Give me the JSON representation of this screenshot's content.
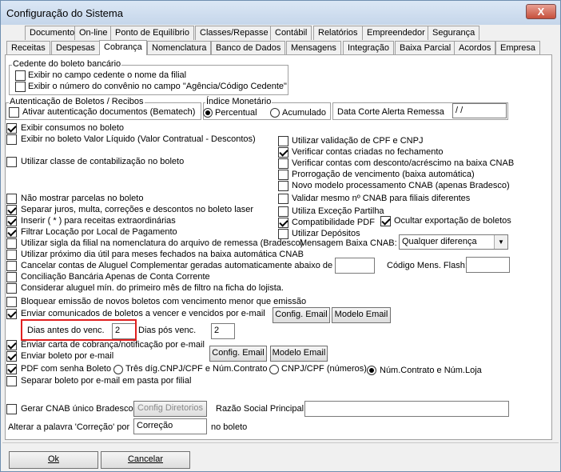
{
  "window": {
    "title": "Configuração do Sistema",
    "close_glyph": "X"
  },
  "tabs_row1": [
    "Documentos",
    "On-line",
    "Ponto de Equilíbrio",
    "Classes/Repasse",
    "Contábil",
    "Relatórios",
    "Empreendedor",
    "Segurança"
  ],
  "tabs_row2": [
    "Receitas",
    "Despesas",
    "Cobrança",
    "Nomenclatura",
    "Banco de Dados",
    "Mensagens",
    "Integração",
    "Baixa Parcial",
    "Acordos",
    "Empresa"
  ],
  "cedente": {
    "title": "Cedente do boleto bancário",
    "opt1": "Exibir no campo cedente o nome da filial",
    "opt2": "Exibir o número do convênio no campo \"Agência/Código Cedente\""
  },
  "autenticacao": {
    "title": "Autenticação de Boletos / Recibos",
    "opt": "Ativar autenticação documentos (Bematech)"
  },
  "indice": {
    "title": "Índice Monetário",
    "opt1": "Percentual",
    "opt2": "Acumulado"
  },
  "alerta": {
    "label": "Data Corte Alerta Remessa",
    "value": "/ /"
  },
  "left_opts": {
    "exibir_consumos": "Exibir consumos no boleto",
    "exibir_liquido": "Exibir no boleto Valor Líquido (Valor Contratual - Descontos)",
    "classe_contab": "Utilizar classe de contabilização no boleto",
    "nao_parcelas": "Não mostrar parcelas no boleto",
    "separar_juros": "Separar juros, multa, correções e descontos no boleto laser",
    "inserir": "Inserir ( * ) para receitas extraordinárias",
    "filtrar": "Filtrar Locação por Local de Pagamento",
    "sigla": "Utilizar sigla da filial na nomenclatura do arquivo de remessa (Bradesco)",
    "proximo_dia": "Utilizar próximo dia útil para meses fechados na baixa automática CNAB",
    "cancelar_aluguel": "Cancelar contas de Aluguel Complementar geradas automaticamente abaixo de R$",
    "conciliacao": "Conciliação Bancária Apenas de Conta Corrente",
    "considerar": "Considerar aluguel mín. do primeiro mês de filtro na ficha do lojista.",
    "bloquear": "Bloquear emissão de novos boletos com vencimento menor que emissão",
    "enviar_comunicados": "Enviar comunicados de boletos a vencer e vencidos por e-mail",
    "enviar_carta": "Enviar carta de cobrança/notificação por e-mail",
    "enviar_boleto": "Enviar boleto por e-mail",
    "pdf_senha": "PDF com senha Boleto",
    "separar_pasta": "Separar boleto por e-mail em pasta por filial"
  },
  "right_opts": {
    "validacao": "Utilizar validação de CPF e CNPJ",
    "verificar_criadas": "Verificar contas criadas no fechamento",
    "verificar_desconto": "Verificar contas com desconto/acréscimo na baixa CNAB",
    "prorrogacao": "Prorrogação de vencimento (baixa automática)",
    "novo_modelo": "Novo modelo processamento CNAB (apenas Bradesco)",
    "validar_cnab": "Validar mesmo nº CNAB para filiais diferentes",
    "excecao": "Utiliza Exceção Partilha",
    "compat_pdf": "Compatibilidade PDF",
    "ocultar": "Ocultar exportação de boletos",
    "depositos": "Utilizar Depósitos"
  },
  "mensagem_baixa": {
    "label": "Mensagem Baixa CNAB:",
    "value": "Qualquer diferença"
  },
  "codigo_flash": {
    "label": "Código Mens. Flash:",
    "value": ""
  },
  "cancelar_valor": "",
  "dias": {
    "antes_label": "Dias antes do venc.",
    "antes_value": "2",
    "pos_label": "Dias pós venc.",
    "pos_value": "2"
  },
  "buttons": {
    "config_email": "Config. Email",
    "modelo_email": "Modelo Email",
    "config_diretorios": "Config Diretorios",
    "ok": "Ok",
    "cancelar": "Cancelar"
  },
  "pdf_radio": {
    "opt1": "Três díg.CNPJ/CPF e Núm.Contrato",
    "opt2": "CNPJ/CPF (números)",
    "opt3": "Núm.Contrato e Núm.Loja"
  },
  "gerar_cnab": "Gerar CNAB único Bradesco",
  "razao_social": {
    "label": "Razão Social Principal",
    "value": ""
  },
  "alterar": {
    "label": "Alterar a palavra 'Correção' por",
    "value": "Correção",
    "suffix": "no boleto"
  }
}
